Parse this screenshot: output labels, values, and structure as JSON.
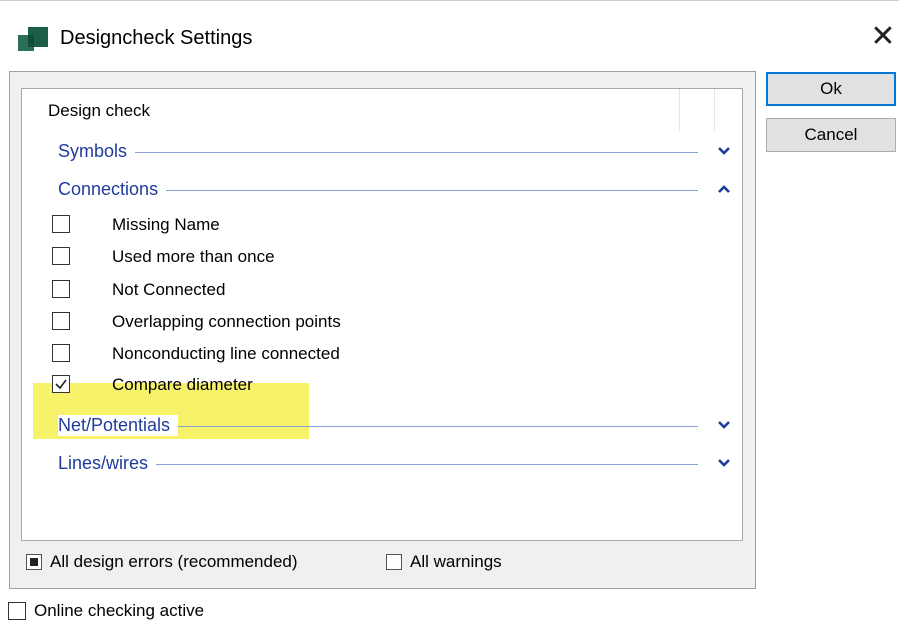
{
  "window": {
    "title": "Designcheck Settings",
    "close_glyph": "✕",
    "icon": "app-logo-icon",
    "accent_color": "#0078d7",
    "section_color": "#1f3b9e",
    "highlight_color": "#f6f36a"
  },
  "list": {
    "header": "Design check",
    "sections": [
      {
        "label": "Symbols",
        "expanded": false,
        "chevron": "⌄"
      },
      {
        "label": "Connections",
        "expanded": true,
        "chevron": "⌃"
      },
      {
        "label": "Net/Potentials",
        "expanded": false,
        "chevron": "⌄"
      },
      {
        "label": "Lines/wires",
        "expanded": false,
        "chevron": "⌄"
      }
    ],
    "connection_items": [
      {
        "label": "Missing Name",
        "checked": false
      },
      {
        "label": "Used more than once",
        "checked": false
      },
      {
        "label": "Not Connected",
        "checked": false
      },
      {
        "label": "Overlapping connection points",
        "checked": false
      },
      {
        "label": "Nonconducting line connected",
        "checked": false
      },
      {
        "label": "Compare diameter",
        "checked": true
      }
    ]
  },
  "options": {
    "all_errors": {
      "label": "All design errors (recommended)",
      "state": "indeterminate"
    },
    "all_warnings": {
      "label": "All warnings",
      "checked": false
    }
  },
  "buttons": {
    "ok": "Ok",
    "cancel": "Cancel"
  },
  "online_checking": {
    "label": "Online checking active",
    "checked": false
  }
}
